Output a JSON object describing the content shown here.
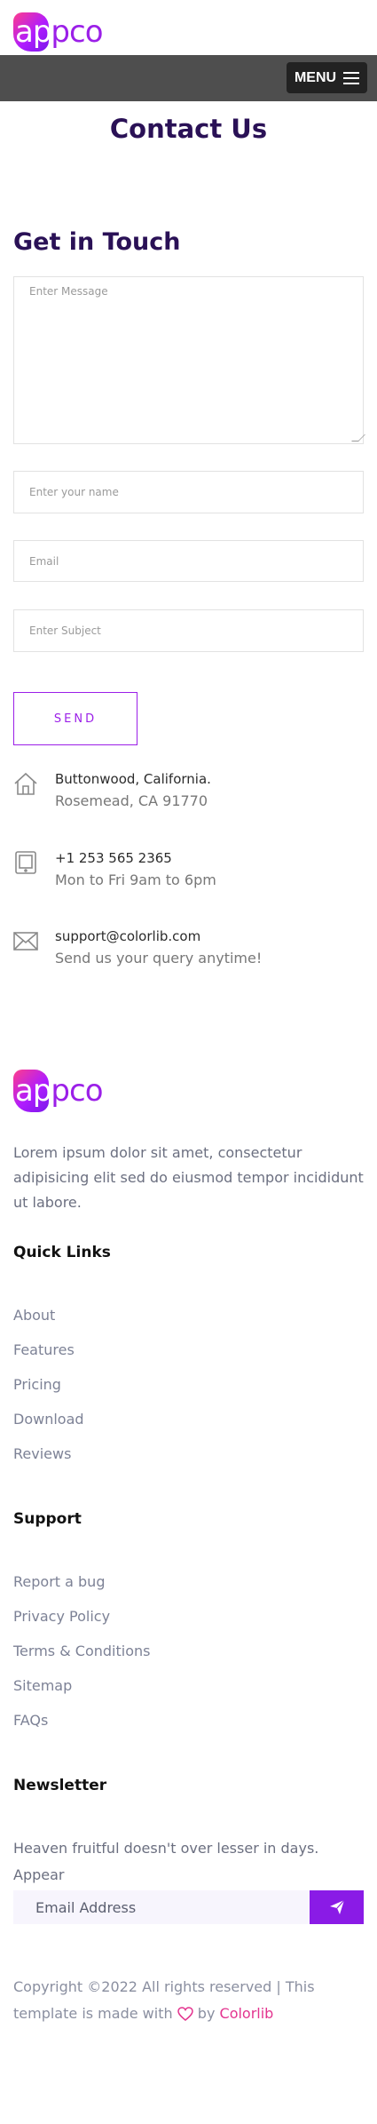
{
  "brand": {
    "logo_part1": "ap",
    "logo_part2": "pco",
    "accent_color": "#9b1fe8",
    "title_color": "#2a1156"
  },
  "nav": {
    "menu_label": "MENU",
    "menu_icon": "hamburger-icon"
  },
  "page": {
    "title": "Contact Us"
  },
  "contact_form": {
    "heading": "Get in Touch",
    "message_placeholder": "Enter Message",
    "name_placeholder": "Enter your name",
    "email_placeholder": "Email",
    "subject_placeholder": "Enter Subject",
    "send_label": "SEND"
  },
  "contact_info": [
    {
      "icon": "home-icon",
      "line1": "Buttonwood, California.",
      "line2": "Rosemead, CA 91770"
    },
    {
      "icon": "tablet-icon",
      "line1": "+1 253 565 2365",
      "line2": "Mon to Fri 9am to 6pm"
    },
    {
      "icon": "email-icon",
      "line1": "support@colorlib.com",
      "line2": "Send us your query anytime!"
    }
  ],
  "footer": {
    "about": "Lorem ipsum dolor sit amet, consectetur adipisicing elit sed do eiusmod tempor incididunt ut labore.",
    "quick_links": {
      "heading": "Quick Links",
      "items": [
        "About",
        "Features",
        "Pricing",
        "Download",
        "Reviews"
      ]
    },
    "support": {
      "heading": "Support",
      "items": [
        "Report a bug",
        "Privacy Policy",
        "Terms & Conditions",
        "Sitemap",
        "FAQs"
      ]
    },
    "newsletter": {
      "heading": "Newsletter",
      "text": "Heaven fruitful doesn't over lesser in days. Appear",
      "input_placeholder": "Email Address",
      "submit_icon": "paper-plane-icon"
    },
    "copyright": {
      "text_before": "Copyright ©2022 All rights reserved | This template is made with",
      "heart_icon": "heart-icon",
      "text_by": "by",
      "credit": "Colorlib",
      "credit_color": "#e3348f"
    }
  }
}
